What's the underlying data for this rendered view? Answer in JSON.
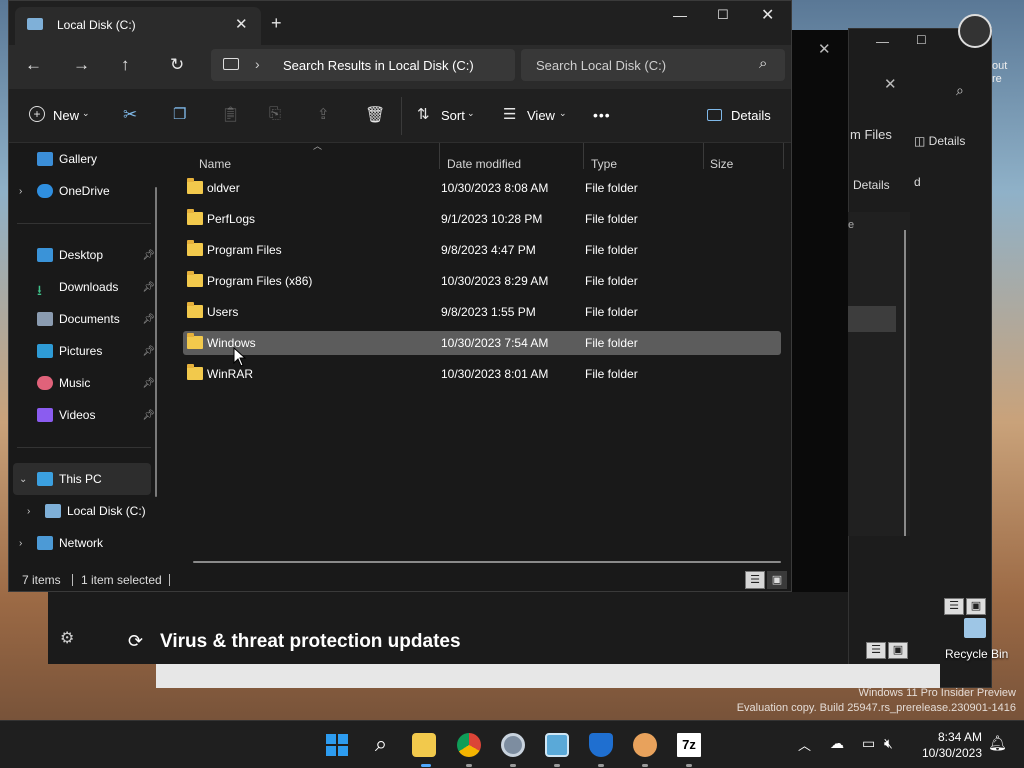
{
  "explorer": {
    "tab_title": "Local Disk (C:)",
    "new_tab_glyph": "+",
    "breadcrumb_sep": "›",
    "address": "Search Results in Local Disk (C:)",
    "search_placeholder": "Search Local Disk (C:)",
    "cmd": {
      "new": "New",
      "sort": "Sort",
      "view": "View",
      "more": "•••",
      "details": "Details"
    },
    "nav": {
      "gallery": "Gallery",
      "onedrive": "OneDrive",
      "desktop": "Desktop",
      "downloads": "Downloads",
      "documents": "Documents",
      "pictures": "Pictures",
      "music": "Music",
      "videos": "Videos",
      "this_pc": "This PC",
      "local_disk": "Local Disk (C:)",
      "network": "Network"
    },
    "columns": {
      "name": "Name",
      "date": "Date modified",
      "type": "Type",
      "size": "Size"
    },
    "rows": [
      {
        "name": "oldver",
        "date": "10/30/2023 8:08 AM",
        "type": "File folder"
      },
      {
        "name": "PerfLogs",
        "date": "9/1/2023 10:28 PM",
        "type": "File folder"
      },
      {
        "name": "Program Files",
        "date": "9/8/2023 4:47 PM",
        "type": "File folder"
      },
      {
        "name": "Program Files (x86)",
        "date": "10/30/2023 8:29 AM",
        "type": "File folder"
      },
      {
        "name": "Users",
        "date": "9/8/2023 1:55 PM",
        "type": "File folder"
      },
      {
        "name": "Windows",
        "date": "10/30/2023 7:54 AM",
        "type": "File folder"
      },
      {
        "name": "WinRAR",
        "date": "10/30/2023 8:01 AM",
        "type": "File folder"
      }
    ],
    "selected_row": "Windows",
    "status": {
      "items": "7 items",
      "selected": "1 item selected"
    }
  },
  "background_window": {
    "partial_label": "m Files",
    "details_1": "Details",
    "details_2": "Details",
    "partial_d": "d",
    "partial_e": "e",
    "partial_paren": ")",
    "partial_out": "out",
    "partial_re": "re"
  },
  "security_banner": {
    "text": "Virus & threat protection updates"
  },
  "desktop": {
    "recycle_bin": "Recycle Bin",
    "watermark_line1": "Windows 11 Pro Insider Preview",
    "watermark_line2": "Evaluation copy. Build 25947.rs_prerelease.230901-1416"
  },
  "taskbar": {
    "time": "8:34 AM",
    "date": "10/30/2023",
    "apps": [
      "start-icon",
      "search-icon",
      "file-explorer-icon",
      "chrome-icon",
      "settings-icon",
      "remote-desktop-icon",
      "defender-icon",
      "app-icon",
      "7zip-icon"
    ],
    "sevenzip_label": "7z"
  },
  "colors": {
    "accent": "#0078d4",
    "folder": "#f2c94c",
    "selection": "#5c5c5c"
  }
}
